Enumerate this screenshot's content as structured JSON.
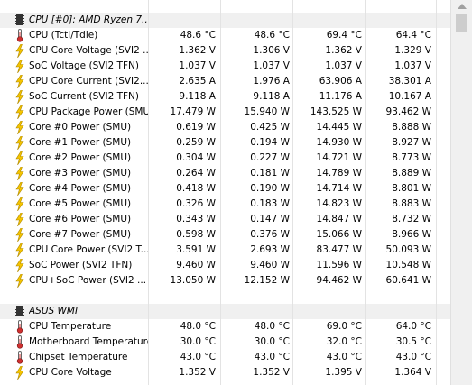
{
  "sections": [
    {
      "title": "CPU [#0]: AMD Ryzen 7...",
      "icon": "chip-icon",
      "rows": [
        {
          "label": "CPU (Tctl/Tdie)",
          "icon": "thermometer-icon",
          "values": [
            "48.6 °C",
            "48.6 °C",
            "69.4 °C",
            "64.4 °C"
          ]
        },
        {
          "label": "CPU Core Voltage (SVI2 ...",
          "icon": "voltage-icon",
          "values": [
            "1.362 V",
            "1.306 V",
            "1.362 V",
            "1.329 V"
          ]
        },
        {
          "label": "SoC Voltage (SVI2 TFN)",
          "icon": "voltage-icon",
          "values": [
            "1.037 V",
            "1.037 V",
            "1.037 V",
            "1.037 V"
          ]
        },
        {
          "label": "CPU Core Current (SVI2...",
          "icon": "voltage-icon",
          "values": [
            "2.635 A",
            "1.976 A",
            "63.906 A",
            "38.301 A"
          ]
        },
        {
          "label": "SoC Current (SVI2 TFN)",
          "icon": "voltage-icon",
          "values": [
            "9.118 A",
            "9.118 A",
            "11.176 A",
            "10.167 A"
          ]
        },
        {
          "label": "CPU Package Power (SMU)",
          "icon": "voltage-icon",
          "values": [
            "17.479 W",
            "15.940 W",
            "143.525 W",
            "93.462 W"
          ]
        },
        {
          "label": "Core #0 Power (SMU)",
          "icon": "voltage-icon",
          "values": [
            "0.619 W",
            "0.425 W",
            "14.445 W",
            "8.888 W"
          ]
        },
        {
          "label": "Core #1 Power (SMU)",
          "icon": "voltage-icon",
          "values": [
            "0.259 W",
            "0.194 W",
            "14.930 W",
            "8.927 W"
          ]
        },
        {
          "label": "Core #2 Power (SMU)",
          "icon": "voltage-icon",
          "values": [
            "0.304 W",
            "0.227 W",
            "14.721 W",
            "8.773 W"
          ]
        },
        {
          "label": "Core #3 Power (SMU)",
          "icon": "voltage-icon",
          "values": [
            "0.264 W",
            "0.181 W",
            "14.789 W",
            "8.889 W"
          ]
        },
        {
          "label": "Core #4 Power (SMU)",
          "icon": "voltage-icon",
          "values": [
            "0.418 W",
            "0.190 W",
            "14.714 W",
            "8.801 W"
          ]
        },
        {
          "label": "Core #5 Power (SMU)",
          "icon": "voltage-icon",
          "values": [
            "0.326 W",
            "0.183 W",
            "14.823 W",
            "8.883 W"
          ]
        },
        {
          "label": "Core #6 Power (SMU)",
          "icon": "voltage-icon",
          "values": [
            "0.343 W",
            "0.147 W",
            "14.847 W",
            "8.732 W"
          ]
        },
        {
          "label": "Core #7 Power (SMU)",
          "icon": "voltage-icon",
          "values": [
            "0.598 W",
            "0.376 W",
            "15.066 W",
            "8.966 W"
          ]
        },
        {
          "label": "CPU Core Power (SVI2 T...",
          "icon": "voltage-icon",
          "values": [
            "3.591 W",
            "2.693 W",
            "83.477 W",
            "50.093 W"
          ]
        },
        {
          "label": "SoC Power (SVI2 TFN)",
          "icon": "voltage-icon",
          "values": [
            "9.460 W",
            "9.460 W",
            "11.596 W",
            "10.548 W"
          ]
        },
        {
          "label": "CPU+SoC Power (SVI2 ...",
          "icon": "voltage-icon",
          "values": [
            "13.050 W",
            "12.152 W",
            "94.462 W",
            "60.641 W"
          ]
        }
      ]
    },
    {
      "title": "ASUS WMI",
      "icon": "chip-icon",
      "rows": [
        {
          "label": "CPU Temperature",
          "icon": "thermometer-icon",
          "values": [
            "48.0 °C",
            "48.0 °C",
            "69.0 °C",
            "64.0 °C"
          ]
        },
        {
          "label": "Motherboard Temperature",
          "icon": "thermometer-icon",
          "values": [
            "30.0 °C",
            "30.0 °C",
            "32.0 °C",
            "30.5 °C"
          ]
        },
        {
          "label": "Chipset Temperature",
          "icon": "thermometer-icon",
          "values": [
            "43.0 °C",
            "43.0 °C",
            "43.0 °C",
            "43.0 °C"
          ]
        },
        {
          "label": "CPU Core Voltage",
          "icon": "voltage-icon",
          "values": [
            "1.352 V",
            "1.352 V",
            "1.395 V",
            "1.364 V"
          ]
        }
      ]
    }
  ],
  "colors": {
    "section_background": "#f0f0f0",
    "grid_line": "#e3e3e3",
    "lightning_yellow": "#f5c400",
    "lightning_outline": "#b08a00",
    "thermometer_red": "#d03030"
  }
}
